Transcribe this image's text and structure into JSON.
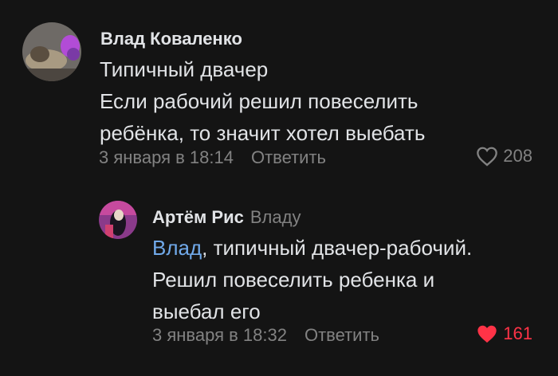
{
  "comments": [
    {
      "author": "Влад Коваленко",
      "lines": [
        "Типичный двачер",
        "Если рабочий решил повеселить",
        "ребёнка, то значит хотел выебать"
      ],
      "date": "3 января в 18:14",
      "reply_label": "Ответить",
      "likes": "208",
      "liked": false
    },
    {
      "author": "Артём Рис",
      "reply_to": "Владу",
      "mention": "Влад",
      "line1_rest": ", типичный двачер-рабочий.",
      "lines_rest": [
        "Решил повеселить ребенка и",
        "выебал его"
      ],
      "date": "3 января в 18:32",
      "reply_label": "Ответить",
      "likes": "161",
      "liked": true
    }
  ],
  "colors": {
    "background": "#141414",
    "text": "#e1e3e6",
    "secondary": "#828282",
    "mention": "#71aaeb",
    "like_active": "#ff3347"
  },
  "icons": {
    "like_empty": "heart-outline-icon",
    "like_filled": "heart-filled-icon"
  }
}
